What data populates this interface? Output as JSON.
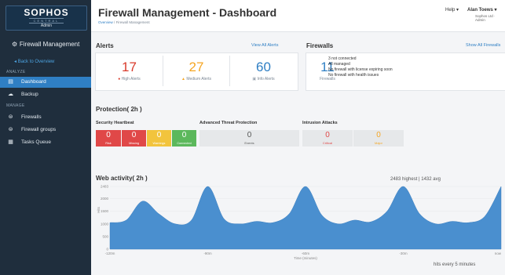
{
  "sidebar": {
    "logo_brand": "SOPHOS",
    "logo_sub": "CENTRAL",
    "logo_admin": "Admin",
    "title": "Firewall Management",
    "back_label": "Back to Overview",
    "analyze_label": "ANALYZE",
    "manage_label": "MANAGE",
    "items": [
      {
        "label": "Dashboard",
        "icon": "chart-icon"
      },
      {
        "label": "Backup",
        "icon": "cloud-icon"
      },
      {
        "label": "Firewalls",
        "icon": "firewall-icon"
      },
      {
        "label": "Firewall groups",
        "icon": "group-icon"
      },
      {
        "label": "Tasks Queue",
        "icon": "tasks-icon"
      }
    ],
    "active_index": 0
  },
  "header": {
    "title": "Firewall Management - Dashboard",
    "breadcrumb_1": "Overview",
    "breadcrumb_sep": "/",
    "breadcrumb_2": "Firewall Management",
    "help_label": "Help ▾",
    "user_label": "Alan Toews ▾",
    "org_label": "Sophos Ltd · Admin"
  },
  "alerts": {
    "title": "Alerts",
    "view_all": "View All Alerts",
    "high": {
      "value": "17",
      "label": "High Alerts",
      "color": "#d93a2b"
    },
    "medium": {
      "value": "27",
      "label": "Medium Alerts",
      "color": "#f5a623"
    },
    "info": {
      "value": "60",
      "label": "Info Alerts",
      "color": "#2f7fc4"
    }
  },
  "firewalls": {
    "title": "Firewalls",
    "show_all": "Show All Firewalls",
    "count": "11",
    "count_label": "Firewalls",
    "status_1": "3 not connected",
    "status_2": "All managed",
    "status_3": "No firewall with license expiring soon",
    "status_4": "No firewall with health issues"
  },
  "protection": {
    "title": "Protection( 2h )",
    "heartbeat_title": "Security Heartbeat",
    "heartbeat": [
      {
        "value": "0",
        "label": "Risk",
        "color": "#e04848"
      },
      {
        "value": "0",
        "label": "Missing",
        "color": "#e04848"
      },
      {
        "value": "0",
        "label": "Warnings",
        "color": "#f2c43d"
      },
      {
        "value": "0",
        "label": "Connected",
        "color": "#5cb85c"
      }
    ],
    "atp_title": "Advanced Threat Protection",
    "atp_value": "0",
    "atp_label": "Events",
    "ips_title": "Intrusion Attacks",
    "ips_critical_value": "0",
    "ips_critical_label": "Critical",
    "ips_major_value": "0",
    "ips_major_label": "Major"
  },
  "web": {
    "title": "Web activity( 2h )",
    "stats": "2483 highest | 1432 avg",
    "hits_note": "hits every 5 minutes"
  },
  "chart_data": {
    "type": "area",
    "ylabel": "Hits",
    "xlabel": "Time (minutes)",
    "ylim": [
      0,
      2483
    ],
    "yticks": [
      "2483",
      "2000",
      "1500",
      "1000",
      "500",
      "0"
    ],
    "ytick_values": [
      2483,
      2000,
      1500,
      1000,
      500,
      0
    ],
    "xticks": [
      "-120m",
      "-90m",
      "-60m",
      "-30m",
      "now"
    ],
    "xtick_values": [
      -120,
      -90,
      -60,
      -30,
      0
    ],
    "x": [
      -120,
      -115,
      -110,
      -105,
      -100,
      -95,
      -90,
      -85,
      -80,
      -75,
      -70,
      -65,
      -60,
      -55,
      -50,
      -45,
      -40,
      -35,
      -30,
      -25,
      -20,
      -15,
      -10,
      -5,
      0
    ],
    "values": [
      1050,
      1150,
      1900,
      1400,
      1000,
      1150,
      2483,
      1200,
      1000,
      1100,
      1050,
      1400,
      2483,
      1350,
      1000,
      1150,
      1080,
      1500,
      2483,
      1400,
      1000,
      1100,
      1050,
      1300,
      2483
    ],
    "color": "#4a8fcf"
  }
}
